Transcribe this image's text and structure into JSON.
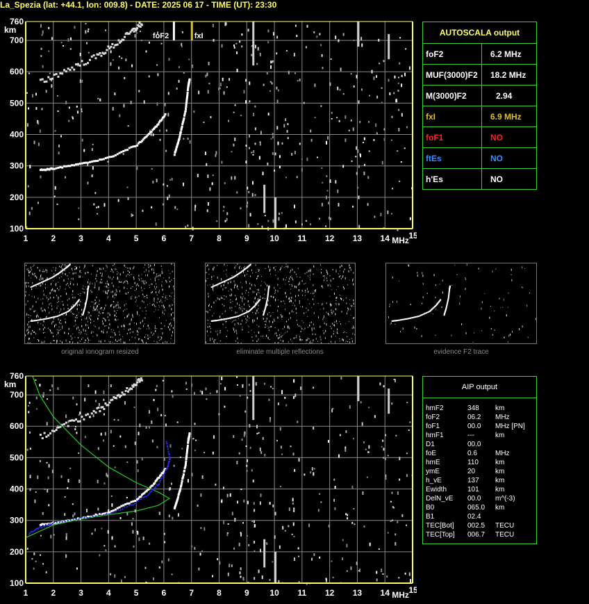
{
  "header": {
    "title": "La_Spezia (lat: +44.1, lon: 009.8) - DATE: 2025 06 17 - TIME (UT): 23:30"
  },
  "colors": {
    "axis": "#ffff66",
    "grid": "#8a8a8a",
    "panel_border": "#3ccf3c",
    "foF1": "#ff2020",
    "ftEs": "#3b8cff",
    "fxI": "#e0c020",
    "profile": "#22cc22",
    "fitted_trace": "#2a2aff"
  },
  "chart_data": [
    {
      "type": "scatter",
      "name": "top-ionogram",
      "xlabel": "MHz",
      "ylabel": "km",
      "xlim": [
        1,
        15
      ],
      "ylim": [
        100,
        760
      ],
      "x_ticks": [
        1,
        2,
        3,
        4,
        5,
        6,
        7,
        8,
        9,
        10,
        11,
        12,
        13,
        14,
        15
      ],
      "y_ticks": [
        100,
        200,
        300,
        400,
        500,
        600,
        700,
        760
      ],
      "grid": true,
      "markers": [
        {
          "label": "foF2",
          "x": 6.2
        },
        {
          "label": "fxI",
          "x": 6.9
        }
      ],
      "traces": [
        {
          "points": [
            [
              1.5,
              290
            ],
            [
              2,
              295
            ],
            [
              3,
              310
            ],
            [
              4,
              330
            ],
            [
              5,
              370
            ],
            [
              5.6,
              420
            ],
            [
              6.05,
              470
            ]
          ]
        },
        {
          "points": [
            [
              6.35,
              340
            ],
            [
              6.55,
              400
            ],
            [
              6.75,
              480
            ],
            [
              6.85,
              560
            ],
            [
              6.9,
              580
            ]
          ]
        },
        {
          "points": [
            [
              1.5,
              570
            ],
            [
              2.5,
              610
            ],
            [
              3.5,
              650
            ],
            [
              4.2,
              690
            ],
            [
              4.8,
              730
            ],
            [
              5.2,
              760
            ]
          ]
        }
      ]
    },
    {
      "type": "scatter",
      "name": "bottom-ionogram",
      "xlabel": "MHz",
      "ylabel": "km",
      "xlim": [
        1,
        15
      ],
      "ylim": [
        100,
        760
      ],
      "x_ticks": [
        1,
        2,
        3,
        4,
        5,
        6,
        7,
        8,
        9,
        10,
        11,
        12,
        13,
        14,
        15
      ],
      "y_ticks": [
        100,
        200,
        300,
        400,
        500,
        600,
        700,
        760
      ],
      "grid": true,
      "traces": [
        {
          "points": [
            [
              1.5,
              290
            ],
            [
              2,
              295
            ],
            [
              3,
              310
            ],
            [
              4,
              330
            ],
            [
              5,
              370
            ],
            [
              5.6,
              420
            ],
            [
              6.05,
              470
            ]
          ]
        },
        {
          "points": [
            [
              6.35,
              340
            ],
            [
              6.55,
              400
            ],
            [
              6.75,
              480
            ],
            [
              6.85,
              560
            ],
            [
              6.9,
              580
            ]
          ]
        },
        {
          "points": [
            [
              1.5,
              570
            ],
            [
              2.5,
              610
            ],
            [
              3.5,
              650
            ],
            [
              4.2,
              690
            ],
            [
              4.8,
              730
            ],
            [
              5.2,
              760
            ]
          ]
        }
      ],
      "profile_curve": [
        [
          1.25,
          760
        ],
        [
          1.5,
          700
        ],
        [
          2,
          630
        ],
        [
          3,
          540
        ],
        [
          4,
          470
        ],
        [
          5,
          420
        ],
        [
          5.8,
          390
        ],
        [
          6.2,
          370
        ],
        [
          5.8,
          348
        ],
        [
          5,
          330
        ],
        [
          4,
          318
        ],
        [
          3,
          305
        ],
        [
          2,
          285
        ],
        [
          1,
          245
        ]
      ],
      "fitted_trace": [
        [
          1.1,
          260
        ],
        [
          1.5,
          280
        ],
        [
          2,
          295
        ],
        [
          3,
          310
        ],
        [
          4,
          325
        ],
        [
          4.8,
          350
        ],
        [
          5.4,
          385
        ],
        [
          5.8,
          420
        ],
        [
          6.1,
          470
        ],
        [
          6.2,
          500
        ],
        [
          6.05,
          560
        ]
      ]
    }
  ],
  "autoscala": {
    "title": "AUTOSCALA output",
    "rows": [
      {
        "key": "foF2",
        "value": "6.2 MHz",
        "color": "#ffffff"
      },
      {
        "key": "MUF(3000)F2",
        "value": "18.2 MHz",
        "color": "#ffffff"
      },
      {
        "key": "M(3000)F2",
        "value": "2.94",
        "color": "#ffffff"
      },
      {
        "key": "fxI",
        "value": "6.9 MHz",
        "color": "#e0c020"
      },
      {
        "key": "foF1",
        "value": "NO",
        "color": "#ff2020"
      },
      {
        "key": "ftEs",
        "value": "NO",
        "color": "#3b8cff"
      },
      {
        "key": "h'Es",
        "value": "NO",
        "color": "#ffffff"
      }
    ]
  },
  "thumbnails": [
    {
      "caption": "original ionogram resized"
    },
    {
      "caption": "eliminate multiple reflections"
    },
    {
      "caption": "evidence F2 trace"
    }
  ],
  "aip": {
    "title": "AIP output",
    "rows": [
      {
        "k": "hmF2",
        "v": "348",
        "u": "km"
      },
      {
        "k": "foF2",
        "v": "06.2",
        "u": "MHz"
      },
      {
        "k": "foF1",
        "v": "00.0",
        "u": "MHz   [PN]"
      },
      {
        "k": "hmF1",
        "v": "---",
        "u": "km"
      },
      {
        "k": "D1",
        "v": "00.0",
        "u": ""
      },
      {
        "k": "foE",
        "v": "0.6",
        "u": "MHz"
      },
      {
        "k": "hmE",
        "v": "110",
        "u": "km"
      },
      {
        "k": "ymE",
        "v": "20",
        "u": "km"
      },
      {
        "k": "h_vE",
        "v": "137",
        "u": "km"
      },
      {
        "k": "Ewidth",
        "v": "101",
        "u": "km"
      },
      {
        "k": "DelN_vE",
        "v": "00.0",
        "u": "m^(-3)"
      },
      {
        "k": "B0",
        "v": "065.0",
        "u": "km"
      },
      {
        "k": "B1",
        "v": "02.4",
        "u": ""
      },
      {
        "k": "TEC[Bot]",
        "v": "002.5",
        "u": "TECU"
      },
      {
        "k": "TEC[Top]",
        "v": "006.7",
        "u": "TECU"
      }
    ]
  }
}
